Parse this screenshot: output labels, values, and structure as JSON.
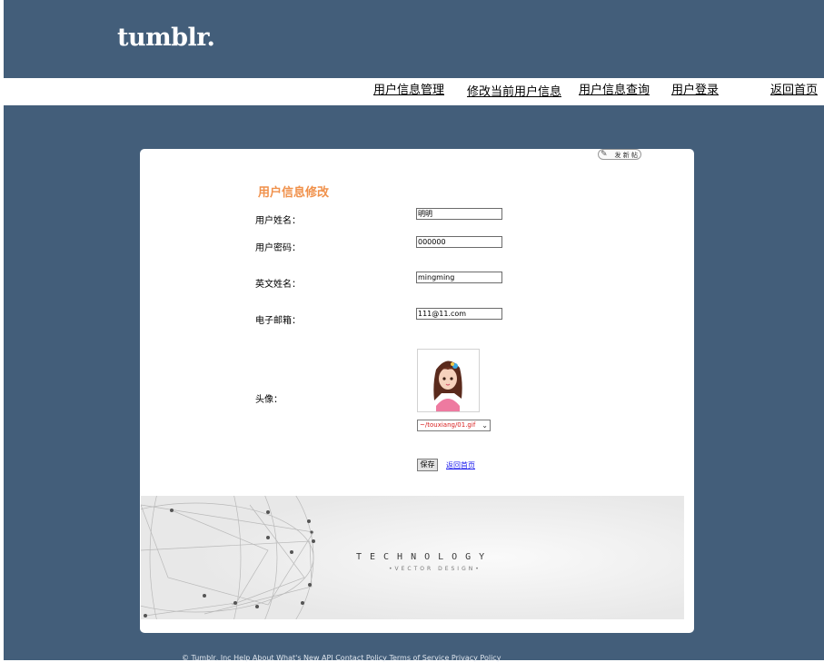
{
  "header": {
    "logo": "tumblr."
  },
  "nav": {
    "items": [
      {
        "label": "用户信息管理"
      },
      {
        "label": "修改当前用户信息"
      },
      {
        "label": "用户信息查询"
      },
      {
        "label": "用户登录"
      },
      {
        "label": "返回首页"
      }
    ]
  },
  "panel": {
    "post_button_label": "发 新 帖",
    "title": "用户信息修改",
    "fields": {
      "name": {
        "label": "用户姓名：",
        "value": "明明"
      },
      "password": {
        "label": "用户密码：",
        "value": "000000"
      },
      "english_name": {
        "label": "英文姓名：",
        "value": "mingming"
      },
      "email": {
        "label": "电子邮箱：",
        "value": "111@11.com"
      },
      "avatar": {
        "label": "头像：",
        "selected": "~/touxiang/01.gif"
      }
    },
    "save_label": "保存",
    "back_label": "返回首页"
  },
  "banner": {
    "title": "TECHNOLOGY",
    "subtitle": "•VECTOR DESIGN•"
  },
  "footer": {
    "text": "© Tumblr, Inc   Help   About   What's New   API   Contact   Policy   Terms of Service   Privacy Policy"
  }
}
